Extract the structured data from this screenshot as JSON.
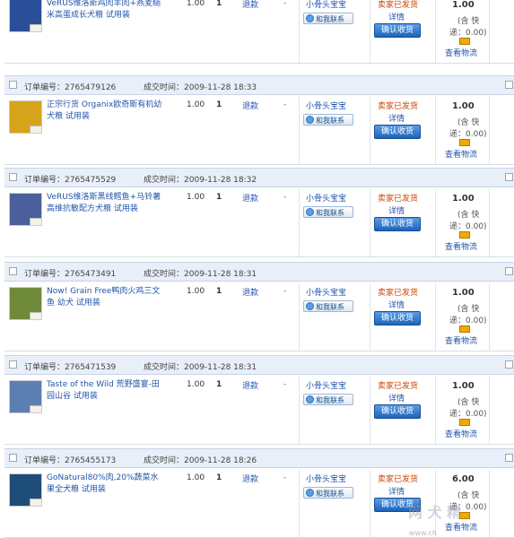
{
  "common": {
    "order_no_label": "订单编号：",
    "time_label": "成交时间：",
    "refund_label": "退款",
    "dash": "-",
    "buyer": "小骨头宝宝",
    "chat_label": "和我联系",
    "status": "卖家已发货",
    "detail": "详情",
    "confirm": "确认收货",
    "ship_prefix": "(含 快",
    "ship_value": "递：0.00)",
    "logistics": "查看物流"
  },
  "orders": [
    {
      "order_no": "",
      "time": "",
      "item": {
        "name": "VeRUS维洛斯鸡肉羊肉+燕麦糙米高蛋成长犬粮 试用装",
        "price": "1.00",
        "qty": "1",
        "total": "1.00",
        "thumb_color": "#2a4f98"
      }
    },
    {
      "order_no": "2765479126",
      "time": "2009-11-28 18:33",
      "item": {
        "name": "正宗行货 Organix欧奇斯有机幼犬粮 试用装",
        "price": "1.00",
        "qty": "1",
        "total": "1.00",
        "thumb_color": "#d6a31a"
      }
    },
    {
      "order_no": "2765475529",
      "time": "2009-11-28 18:32",
      "item": {
        "name": "VeRUS维洛斯黑线鳕鱼+马铃薯高维抗敏配方犬粮 试用装",
        "price": "1.00",
        "qty": "1",
        "total": "1.00",
        "thumb_color": "#4b5f9a"
      }
    },
    {
      "order_no": "2765473491",
      "time": "2009-11-28 18:31",
      "item": {
        "name": "Now! Grain Free鸭肉火鸡三文鱼 幼犬 试用装",
        "price": "1.00",
        "qty": "1",
        "total": "1.00",
        "thumb_color": "#6e8a38"
      }
    },
    {
      "order_no": "2765471539",
      "time": "2009-11-28 18:31",
      "item": {
        "name": "Taste of the Wild 荒野盛宴-田园山谷 试用装",
        "price": "1.00",
        "qty": "1",
        "total": "1.00",
        "thumb_color": "#5b7fb0"
      }
    },
    {
      "order_no": "2765455173",
      "time": "2009-11-28 18:26",
      "item": {
        "name": "GoNatural80%肉,20%蔬菜水果全犬粮 试用装",
        "price": "1.00",
        "qty": "1",
        "total": "6.00",
        "thumb_color": "#1f4d7a"
      }
    }
  ],
  "watermark": {
    "text": "网 犬 精",
    "site": "www.ch"
  }
}
